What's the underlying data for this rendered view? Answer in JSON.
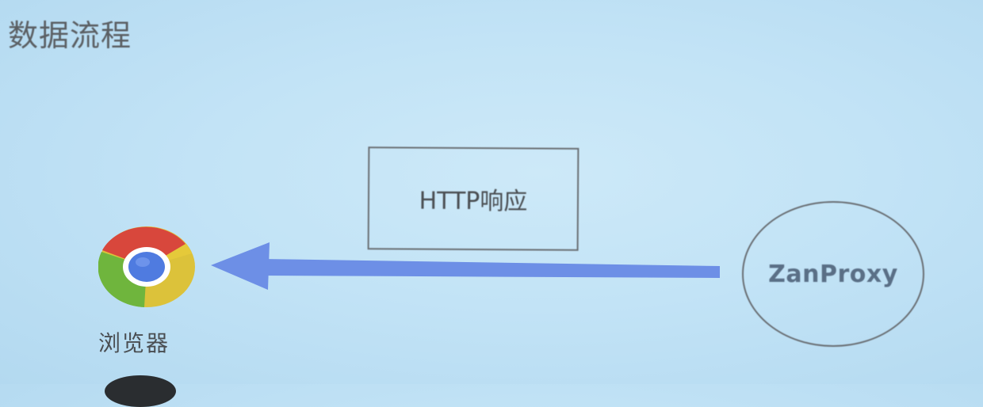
{
  "slide": {
    "title": "数据流程"
  },
  "diagram": {
    "response_box": {
      "label": "HTTP响应"
    },
    "proxy_node": {
      "label": "ZanProxy"
    },
    "browser_node": {
      "label": "浏览器",
      "icon": "chrome-icon"
    },
    "arrow": {
      "direction": "proxy-to-browser",
      "color": "#6d8fe6"
    }
  }
}
